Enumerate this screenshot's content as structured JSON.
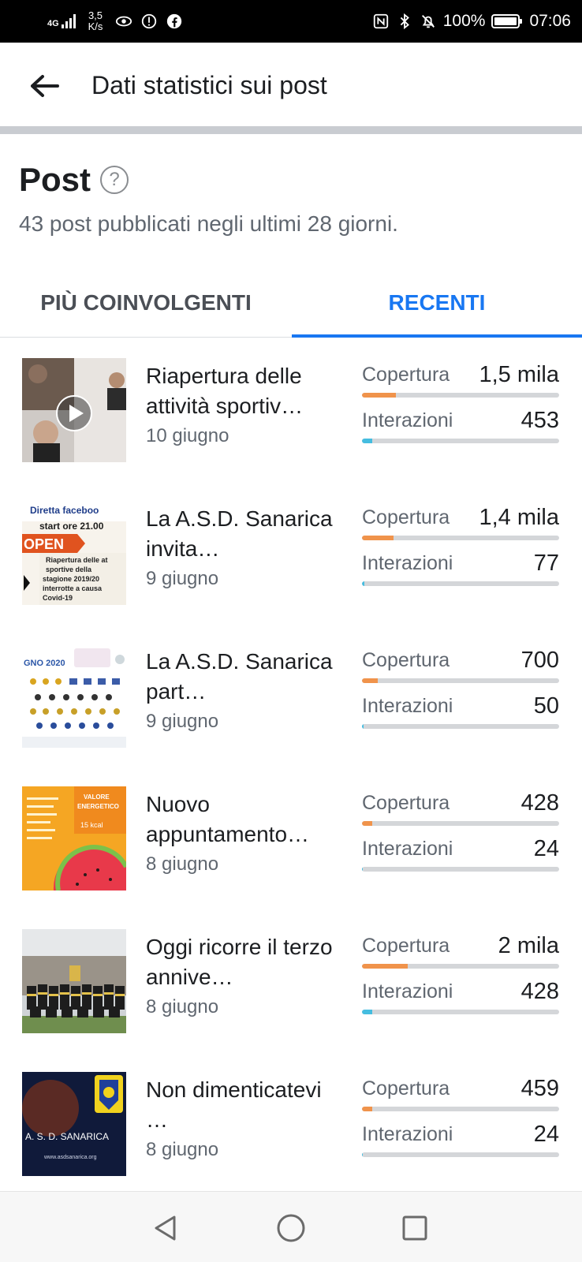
{
  "status_bar": {
    "network": "4G",
    "speed_value": "3,5",
    "speed_unit": "K/s",
    "battery": "100%",
    "time": "07:06",
    "icons": [
      "signal-icon",
      "eye-icon",
      "alert-icon",
      "facebook-icon",
      "nfc-icon",
      "bluetooth-icon",
      "mute-icon",
      "battery-icon"
    ]
  },
  "header": {
    "title": "Dati statistici sui post",
    "back_icon": "arrow-left-icon"
  },
  "section": {
    "title": "Post",
    "help_icon": "?",
    "subtitle": "43 post pubblicati negli ultimi 28 giorni."
  },
  "tabs": [
    {
      "label": "PIÙ COINVOLGENTI",
      "active": false
    },
    {
      "label": "RECENTI",
      "active": true
    }
  ],
  "metric_labels": {
    "reach": "Copertura",
    "engagement": "Interazioni"
  },
  "posts": [
    {
      "title": "Riapertura delle attività sportiv…",
      "date": "10 giugno",
      "reach": "1,5 mila",
      "engagement": "453",
      "reach_fraction": 0.17,
      "engagement_fraction": 0.05,
      "thumb": "video call thumbnail with play icon"
    },
    {
      "title": "La A.S.D. Sanarica invita…",
      "date": "9 giugno",
      "reach": "1,4 mila",
      "engagement": "77",
      "reach_fraction": 0.16,
      "engagement_fraction": 0.01,
      "thumb_text": [
        "Diretta faceboo",
        "start ore 21.00",
        "OPEN",
        "Riapertura delle at",
        "sportive della",
        "stagione 2019/20",
        "interrotte a causa",
        "Covid-19"
      ]
    },
    {
      "title": "La A.S.D. Sanarica part…",
      "date": "9 giugno",
      "reach": "700",
      "engagement": "50",
      "reach_fraction": 0.08,
      "engagement_fraction": 0.008,
      "thumb_text": [
        "GNO 2020"
      ]
    },
    {
      "title": "Nuovo appuntamento…",
      "date": "8 giugno",
      "reach": "428",
      "engagement": "24",
      "reach_fraction": 0.05,
      "engagement_fraction": 0.005,
      "thumb_text": [
        "VALORE",
        "ENERGETICO",
        "15 kcal"
      ]
    },
    {
      "title": "Oggi ricorre il terzo annive…",
      "date": "8 giugno",
      "reach": "2 mila",
      "engagement": "428",
      "reach_fraction": 0.23,
      "engagement_fraction": 0.05,
      "thumb": "team photo"
    },
    {
      "title": "Non dimenticatevi …",
      "date": "8 giugno",
      "reach": "459",
      "engagement": "24",
      "reach_fraction": 0.05,
      "engagement_fraction": 0.005,
      "thumb_text": [
        "A. S. D. SANARICA",
        "www.asdsanarica.org"
      ]
    }
  ],
  "nav": {
    "back": "triangle-back-icon",
    "home": "circle-home-icon",
    "recents": "square-recents-icon"
  }
}
